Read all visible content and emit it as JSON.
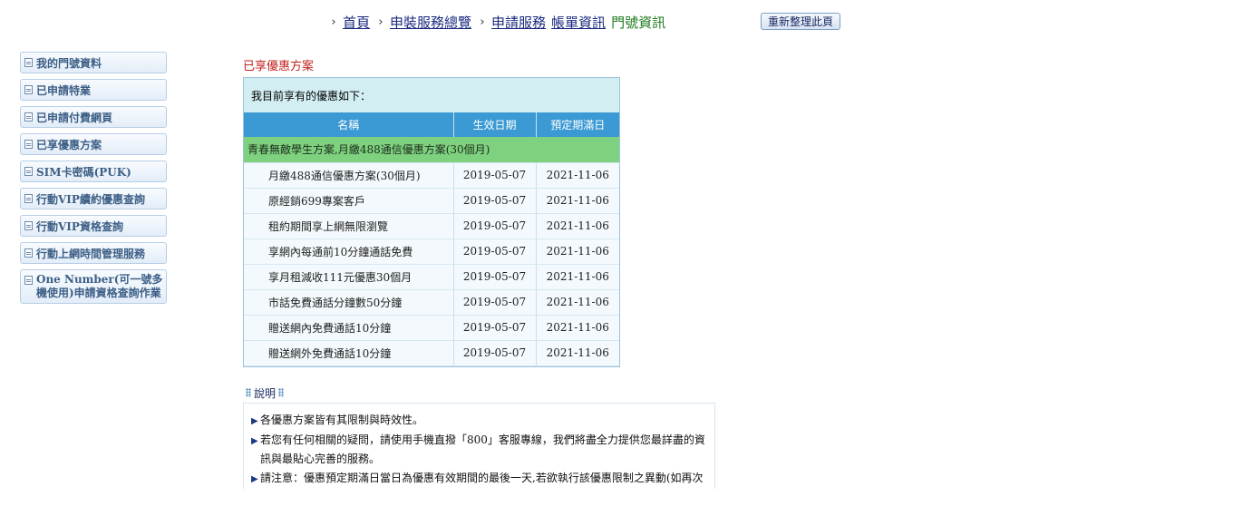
{
  "breadcrumb": {
    "items": [
      {
        "label": "首頁"
      },
      {
        "label": "申裝服務總覽"
      },
      {
        "label": "申請服務"
      },
      {
        "label": "帳單資訊"
      },
      {
        "label": "門號資訊"
      }
    ],
    "chevron": "›"
  },
  "refresh_label": "重新整理此頁",
  "sidebar": {
    "items": [
      {
        "label": "我的門號資料"
      },
      {
        "label": "已申請特業"
      },
      {
        "label": "已申請付費網頁"
      },
      {
        "label": "已享優惠方案"
      },
      {
        "label": "SIM卡密碼(PUK)"
      },
      {
        "label": "行動VIP續約優惠查詢"
      },
      {
        "label": "行動VIP資格查詢"
      },
      {
        "label": "行動上網時間管理服務"
      },
      {
        "label": "One Number(可一號多機使用)申請資格查詢作業"
      }
    ]
  },
  "section_title": "已享優惠方案",
  "offers": {
    "intro": "我目前享有的優惠如下：",
    "headers": {
      "name": "名稱",
      "start": "生效日期",
      "end": "預定期滿日"
    },
    "plan": "青春無敵學生方案,月繳488通信優惠方案(30個月)",
    "rows": [
      {
        "name": "月繳488通信優惠方案(30個月)",
        "start": "2019-05-07",
        "end": "2021-11-06"
      },
      {
        "name": "原經銷699專案客戶",
        "start": "2019-05-07",
        "end": "2021-11-06"
      },
      {
        "name": "租約期間享上網無限瀏覽",
        "start": "2019-05-07",
        "end": "2021-11-06"
      },
      {
        "name": "享網內每通前10分鐘通話免費",
        "start": "2019-05-07",
        "end": "2021-11-06"
      },
      {
        "name": "享月租減收111元優惠30個月",
        "start": "2019-05-07",
        "end": "2021-11-06"
      },
      {
        "name": "市話免費通話分鐘數50分鐘",
        "start": "2019-05-07",
        "end": "2021-11-06"
      },
      {
        "name": "贈送網內免費通話10分鐘",
        "start": "2019-05-07",
        "end": "2021-11-06"
      },
      {
        "name": "贈送網外免費通話10分鐘",
        "start": "2019-05-07",
        "end": "2021-11-06"
      }
    ]
  },
  "notes": {
    "title": "說明",
    "items": [
      "各優惠方案皆有其限制與時效性。",
      "若您有任何相關的疑問，請使用手機直撥「800」客服專線，我們將盡全力提供您最詳盡的資訊與最貼心完善的服務。",
      "請注意：優惠預定期滿日當日為優惠有效期間的最後一天,若欲執行該優惠限制之異動(如再次"
    ]
  },
  "colors": {
    "header_blue": "#3b99d3",
    "plan_green": "#7ed17e",
    "title_red": "#c0231e",
    "current_green": "#1c7a1c",
    "link_blue": "#1b2a80"
  }
}
